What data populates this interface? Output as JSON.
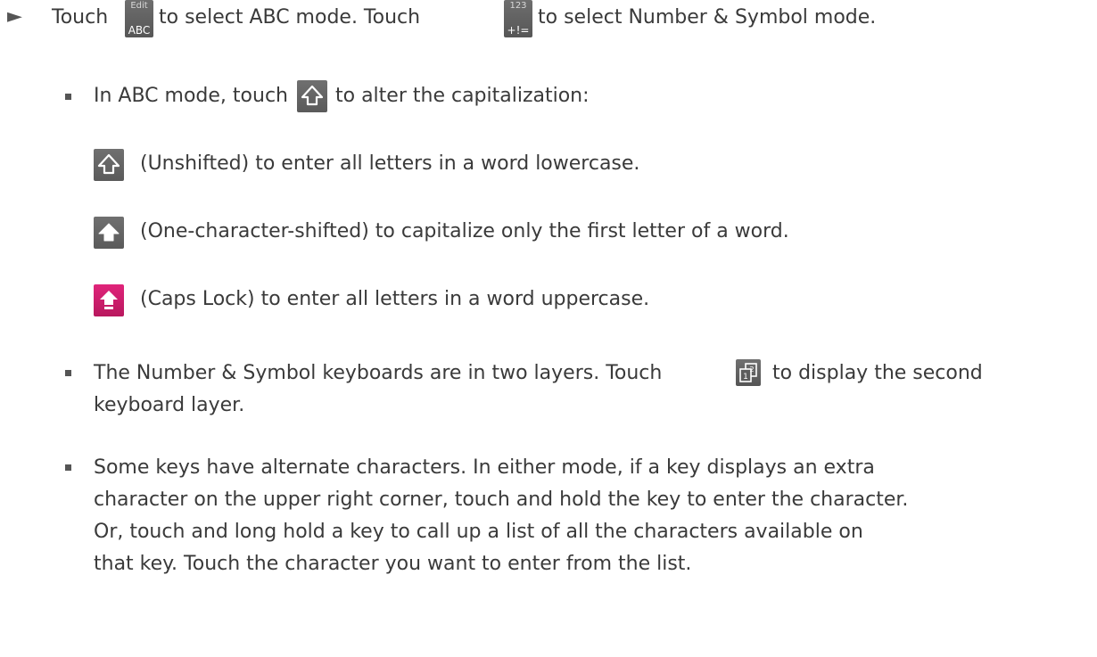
{
  "instructions": {
    "line1": {
      "touch": "Touch",
      "abc_key": {
        "sup": "Edit",
        "main": "ABC"
      },
      "select_abc": "to select ABC mode. Touch",
      "num_key": {
        "sup": "123",
        "main": "+!="
      },
      "select_num": "to select Number & Symbol mode."
    },
    "abc_mode": {
      "before": "In ABC mode, touch",
      "after": "to alter the capitalization:"
    },
    "unshifted": "(Unshifted) to enter all letters in a word lowercase.",
    "one_shifted": "(One-character-shifted) to capitalize only the first letter of a word.",
    "caps_lock": "(Caps Lock) to enter all letters in a word uppercase.",
    "layers": {
      "before": "The Number & Symbol keyboards are in two layers. Touch",
      "after": "to display the second",
      "line2": "keyboard layer."
    },
    "alternate": {
      "line1": "Some keys have alternate characters. In either mode, if a key displays an extra",
      "line2": "character on the upper right corner, touch and hold the key to enter the character.",
      "line3": "Or, touch and long hold a key to call up a list of all the characters available on",
      "line4": "that key. Touch the character you want to enter from the list."
    }
  },
  "icons": {
    "arrow": "right-pointer-arrow-icon",
    "shift_outline": "shift-outline-icon",
    "shift_filled": "shift-filled-icon",
    "caps_lock": "caps-lock-icon",
    "layer_switch": "layer-switch-icon"
  },
  "colors": {
    "text": "#3a3a3a",
    "key_gray": "#6a6a6a",
    "caps_pink": "#d01f6e"
  }
}
